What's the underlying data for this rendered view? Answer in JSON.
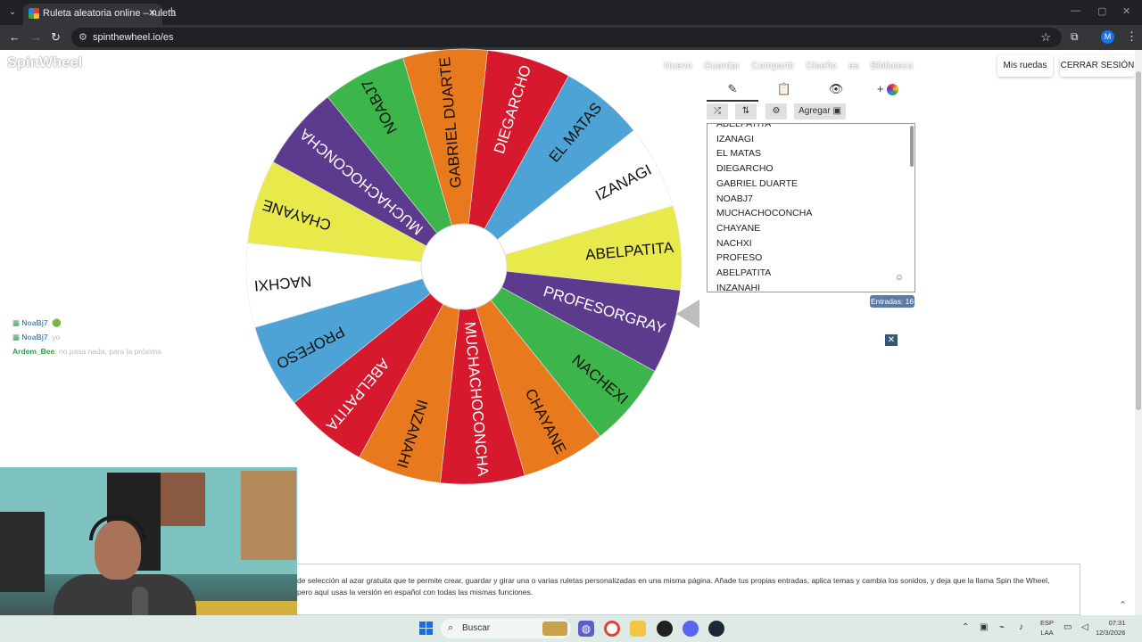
{
  "browser": {
    "tab_title": "Ruleta aleatoria online – ruleta",
    "tab_close": "✕",
    "new_tab": "+",
    "url": "spinthewheel.io/es",
    "profile_initial": "M",
    "back": "←",
    "forward": "→",
    "reload": "↻",
    "star": "☆",
    "extensions": "⧉",
    "menu": "⋮",
    "minimize": "—",
    "maximize": "▢",
    "close": "✕"
  },
  "header": {
    "logo": "SpinWheel",
    "nav": [
      "Nuevo",
      "Guardar",
      "Compartir",
      "Diseño",
      "es",
      "Biblioteca"
    ],
    "mis_ruedas": "Mis ruedas",
    "cerrar_sesion": "CERRAR SESIÓN"
  },
  "wheel": {
    "segments": [
      {
        "label": "ABELPATITA",
        "color": "#e8ea4b",
        "text_color": "#111111"
      },
      {
        "label": "PROFESORGRAY",
        "color": "#5c3a8e",
        "text_color": "#ffffff"
      },
      {
        "label": "NACHEXI",
        "color": "#3cb54a",
        "text_color": "#111111"
      },
      {
        "label": "CHAYANE",
        "color": "#e8791c",
        "text_color": "#111111"
      },
      {
        "label": "MUCHACHOCONCHA",
        "color": "#d7192e",
        "text_color": "#ffffff"
      },
      {
        "label": "INZANAHI",
        "color": "#e8791c",
        "text_color": "#111111"
      },
      {
        "label": "ABELPATITA",
        "color": "#d7192e",
        "text_color": "#ffffff"
      },
      {
        "label": "PROFESO",
        "color": "#4da3d5",
        "text_color": "#111111"
      },
      {
        "label": "NACHXI",
        "color": "#ffffff",
        "text_color": "#111111"
      },
      {
        "label": "CHAYANE",
        "color": "#e8ea4b",
        "text_color": "#111111"
      },
      {
        "label": "MUCHACHOCONCHA",
        "color": "#5c3a8e",
        "text_color": "#ffffff"
      },
      {
        "label": "NOABJ7",
        "color": "#3cb54a",
        "text_color": "#111111"
      },
      {
        "label": "GABRIEL DUARTE",
        "color": "#e8791c",
        "text_color": "#111111"
      },
      {
        "label": "DIEGARCHO",
        "color": "#d7192e",
        "text_color": "#ffffff"
      },
      {
        "label": "EL MATAS",
        "color": "#4da3d5",
        "text_color": "#111111"
      },
      {
        "label": "IZANAGI",
        "color": "#ffffff",
        "text_color": "#111111"
      }
    ]
  },
  "panel": {
    "tab_icons": [
      "pencil-icon",
      "clipboard-icon",
      "eye-off-icon",
      "plus-icon"
    ],
    "tab_glyphs": [
      "✎",
      "📋",
      "👁",
      "+"
    ],
    "toolbar": {
      "shuffle": "⤮",
      "sort": "⇅",
      "settings": "⚙",
      "add_label": "Agregar"
    },
    "entries": [
      "ABELPATITA",
      "IZANAGI",
      "EL MATAS",
      "DIEGARCHO",
      "GABRIEL DUARTE",
      "NOABJ7",
      "MUCHACHOCONCHA",
      "CHAYANE",
      "NACHXI",
      "PROFESO",
      "ABELPATITA",
      "INZANAHI"
    ],
    "count_label": "Entradas: 16",
    "ad_close": "✕",
    "emoji": "☺"
  },
  "chat": [
    {
      "user": "NoaBj7",
      "msg": ": 🟢"
    },
    {
      "user": "NoaBj7",
      "msg": ": yo"
    },
    {
      "user": "Ardem_Bee",
      "msg": ": no pasa nada, para la próxima"
    }
  ],
  "description": "de selección al azar gratuita que te permite crear, guardar y girar una o varias ruletas personalizadas en una misma página. Añade tus propias entradas, aplica temas y cambia los sonidos, y deja que la llama Spin the Wheel, pero aquí usas la versión en español con todas las mismas funciones.",
  "taskbar": {
    "search_label": "Buscar",
    "lang_top": "ESP",
    "lang_bottom": "LAA",
    "time": "07:31",
    "date": "12/3/2026"
  }
}
